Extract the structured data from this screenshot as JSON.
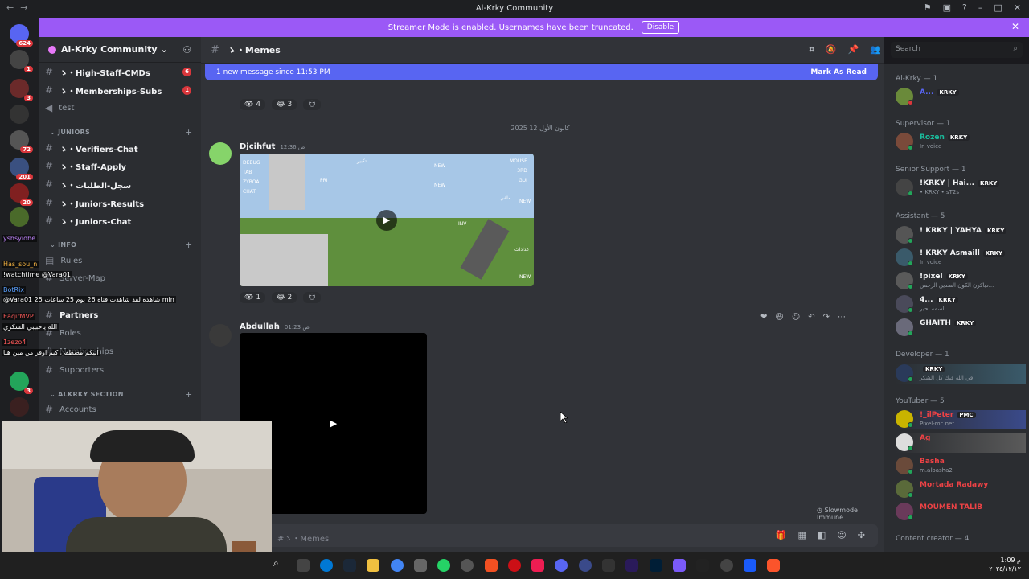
{
  "window": {
    "title": "Al-Krky Community"
  },
  "banner": {
    "text": "Streamer Mode is enabled. Usernames have been truncated.",
    "disable_label": "Disable",
    "accent": "#9b59f6"
  },
  "rail": {
    "top_badge": "624",
    "badges": [
      "1",
      "3",
      "72",
      "201",
      "20",
      "3"
    ]
  },
  "sidebar": {
    "server_name": "Al-Krky Community",
    "channels": [
      {
        "name": "ゝ・High-Staff-CMDs",
        "count": "6"
      },
      {
        "name": "ゝ・Memberships-Subs",
        "count": "1"
      },
      {
        "name": "test"
      }
    ],
    "juniors_category": "JUNIORS",
    "juniors_channels": [
      {
        "name": "ゝ・Verifiers-Chat"
      },
      {
        "name": "ゝ・Staff-Apply"
      },
      {
        "name": "ゝ・سجل-الطلبات"
      },
      {
        "name": "ゝ・Juniors-Results"
      },
      {
        "name": "ゝ・Juniors-Chat"
      }
    ],
    "info_category": "INFO",
    "info_channels": [
      {
        "name": "Rules"
      },
      {
        "name": "Server-Map"
      },
      {
        "name": "Partners"
      },
      {
        "name": "Roles"
      },
      {
        "name": "Memberships"
      },
      {
        "name": "Supporters"
      }
    ],
    "alkrky_category": "ALKRKY SECTION",
    "alkrky_channels": [
      {
        "name": "Accounts"
      }
    ]
  },
  "chat_overlay": {
    "lines": [
      "yshsyidhe",
      "Has_sou_n",
      "!watchtime @Vara01",
      "BotRix",
      "@Vara01 25 شاهدة لقد شاهدت قناة 26 يوم 25 ساعات min",
      "EaqirMVP",
      "الله ياحبيبي الشكري",
      "1zezo4",
      "ابيكم مصطفى كيم اوفر من مين هنا"
    ]
  },
  "main": {
    "channel_name": "ゝ・Memes",
    "search_placeholder": "Search",
    "new_messages": "1 new message since 11:53 PM",
    "mark_as_read": "Mark As Read",
    "reactions_1": [
      {
        "emoji": "👁",
        "count": "4"
      },
      {
        "emoji": "😂",
        "count": "3"
      }
    ],
    "date_separator": "كانون الأول 12 2025",
    "message_1": {
      "author": "Djcihfut",
      "time": "12:36 ص"
    },
    "reactions_2": [
      {
        "emoji": "👁",
        "count": "1"
      },
      {
        "emoji": "😂",
        "count": "2"
      }
    ],
    "message_2": {
      "author": "Abdullah",
      "time": "01:23 ص"
    },
    "slowmode": "Slowmode Immune",
    "composer_placeholder": "#ゝ・Memes",
    "video_labels": [
      "DEBUG",
      "TAB",
      "ZYBOA",
      "CHAT",
      "PRI",
      "NEW",
      "NEW",
      "INV",
      "MOUSE",
      "3RD",
      "GUI",
      "NEW",
      "NEW",
      "تكبير",
      "عدادات",
      "ملفي",
      "اخفاء"
    ]
  },
  "members": {
    "groups": [
      {
        "role": "Al-Krky — 1",
        "members": [
          {
            "name": "A...",
            "tag": "KRKY",
            "sub": "",
            "color": "#5865f2"
          }
        ]
      },
      {
        "role": "Supervisor — 1",
        "members": [
          {
            "name": "Rozen",
            "tag": "KRKY",
            "sub": "In voice",
            "color": "#1abc9c"
          }
        ]
      },
      {
        "role": "Senior Support — 1",
        "members": [
          {
            "name": "!KRKY | Hai...",
            "tag": "KRKY",
            "sub": "• KRKY • sT2s",
            "color": "#f2f3f5"
          }
        ]
      },
      {
        "role": "Assistant — 5",
        "members": [
          {
            "name": "! KRKY | YAHYA",
            "tag": "KRKY",
            "sub": "",
            "color": "#f2f3f5"
          },
          {
            "name": "! KRKY Asmaill",
            "tag": "KRKY",
            "sub": "In voice",
            "color": "#f2f3f5"
          },
          {
            "name": "!pixel",
            "tag": "KRKY",
            "sub": "دياكرن الكون الضدين الرحمن...",
            "color": "#f2f3f5"
          },
          {
            "name": "4...",
            "tag": "KRKY",
            "sub": "اسمه بحير",
            "color": "#f2f3f5"
          },
          {
            "name": "GHAITH",
            "tag": "KRKY",
            "sub": "",
            "color": "#f2f3f5"
          }
        ]
      },
      {
        "role": "Developer — 1",
        "members": [
          {
            "name": "",
            "tag": "KRKY",
            "sub": "في الله فيك كل الشكر",
            "color": "#f2f3f5"
          }
        ]
      },
      {
        "role": "YouTuber — 5",
        "members": [
          {
            "name": "!_ilPeter",
            "tag": "PMC",
            "sub": "Pixel-mc.net",
            "color": "#ed4245"
          },
          {
            "name": "Ag",
            "tag": "",
            "sub": "",
            "color": "#ed4245"
          },
          {
            "name": "Basha",
            "tag": "",
            "sub": "m.albasha2",
            "color": "#ed4245"
          },
          {
            "name": "Mortada Radawy",
            "tag": "",
            "sub": "",
            "color": "#ed4245"
          },
          {
            "name": "MOUMEN TALIB",
            "tag": "",
            "sub": "",
            "color": "#ed4245"
          }
        ]
      },
      {
        "role": "Content creator — 4",
        "members": []
      }
    ]
  },
  "taskbar": {
    "time": "1:09 م",
    "date": "٢٠٢٥/١٢/١٢"
  }
}
